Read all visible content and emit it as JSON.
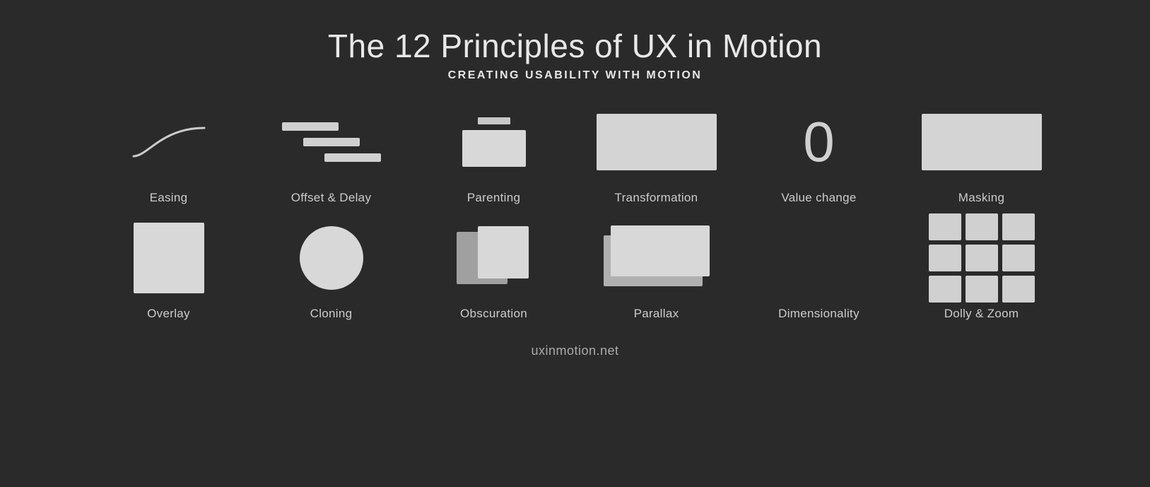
{
  "header": {
    "title": "The 12 Principles of UX in Motion",
    "subtitle": "CREATING USABILITY WITH MOTION"
  },
  "row1": [
    {
      "id": "easing",
      "label": "Easing"
    },
    {
      "id": "offset-delay",
      "label": "Offset & Delay"
    },
    {
      "id": "parenting",
      "label": "Parenting"
    },
    {
      "id": "transformation",
      "label": "Transformation"
    },
    {
      "id": "value-change",
      "label": "Value change"
    },
    {
      "id": "masking",
      "label": "Masking"
    }
  ],
  "row2": [
    {
      "id": "overlay",
      "label": "Overlay"
    },
    {
      "id": "cloning",
      "label": "Cloning"
    },
    {
      "id": "obscuration",
      "label": "Obscuration"
    },
    {
      "id": "parallax",
      "label": "Parallax"
    },
    {
      "id": "dimensionality",
      "label": "Dimensionality"
    },
    {
      "id": "dolly-zoom",
      "label": "Dolly & Zoom"
    }
  ],
  "footer": {
    "url": "uxinmotion.net"
  },
  "value_change_symbol": "0"
}
